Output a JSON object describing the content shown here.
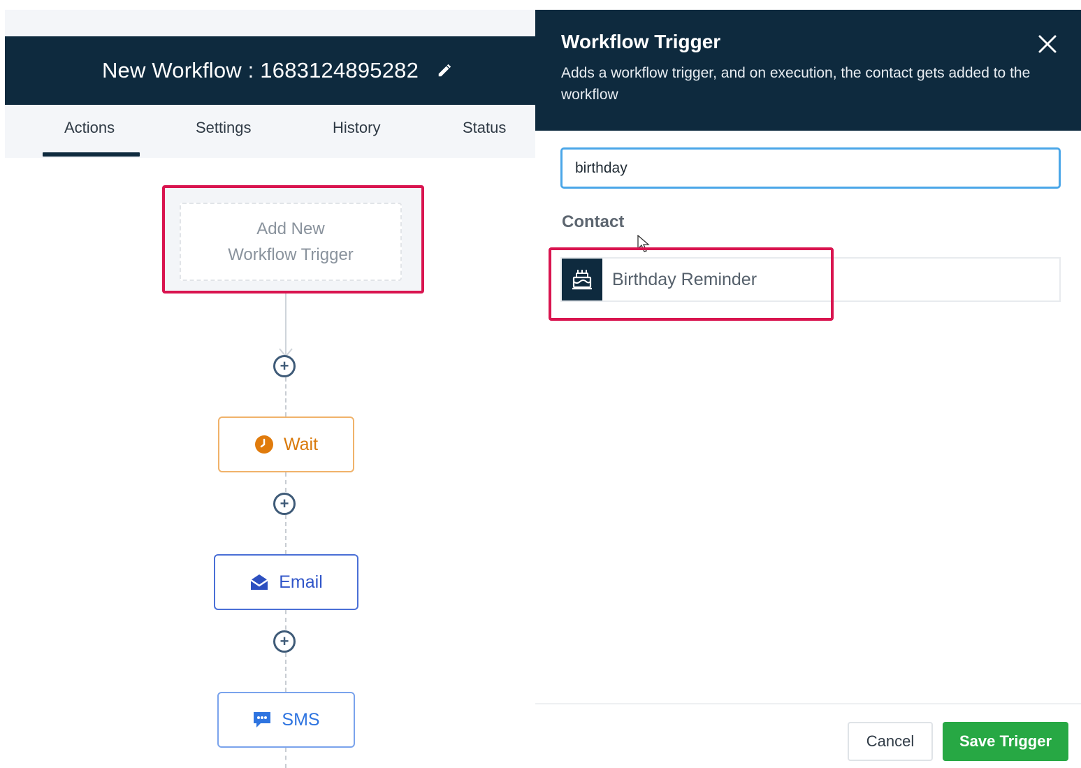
{
  "workflow": {
    "title": "New Workflow : 1683124895282",
    "tabs": [
      {
        "label": "Actions",
        "active": true
      },
      {
        "label": "Settings"
      },
      {
        "label": "History"
      },
      {
        "label": "Status"
      }
    ]
  },
  "canvas": {
    "trigger": {
      "line1": "Add New",
      "line2": "Workflow Trigger"
    },
    "actions": [
      {
        "label": "Wait",
        "icon": "clock-icon",
        "color": "#d97a0b"
      },
      {
        "label": "Email",
        "icon": "envelope-icon",
        "color": "#3156c9"
      },
      {
        "label": "SMS",
        "icon": "chat-icon",
        "color": "#2e74e0"
      }
    ]
  },
  "panel": {
    "title": "Workflow Trigger",
    "description": "Adds a workflow trigger, and on execution, the contact gets added to the workflow",
    "search": {
      "value": "birthday"
    },
    "section_label": "Contact",
    "result": {
      "label": "Birthday Reminder",
      "icon": "birthday-cake-icon"
    },
    "cancel_label": "Cancel",
    "save_label": "Save Trigger"
  },
  "colors": {
    "header_bg": "#0e2a3e",
    "highlight": "#d9144f",
    "save_green": "#27a844",
    "input_focus": "#4aa6e8"
  }
}
